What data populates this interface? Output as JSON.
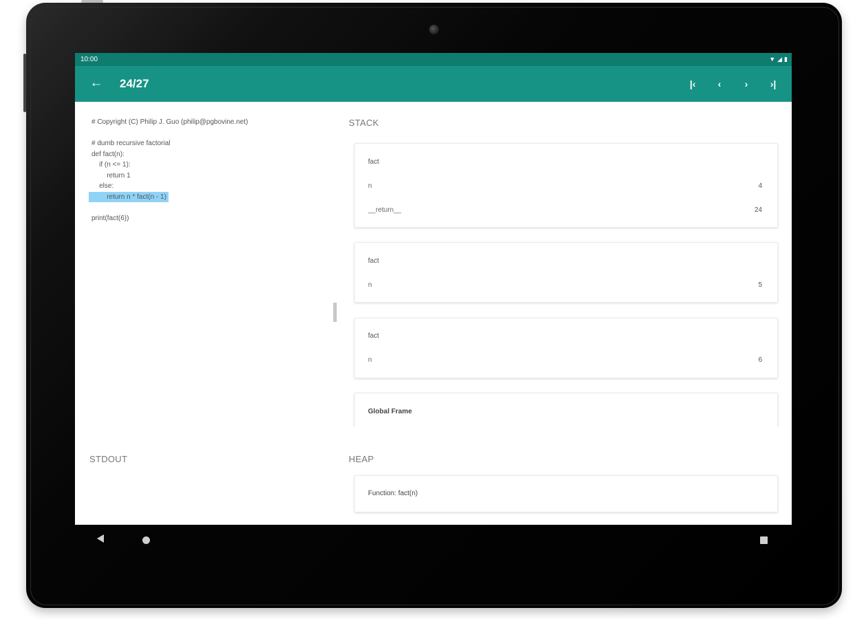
{
  "statusbar": {
    "time": "10:00",
    "icons": [
      "wifi-icon",
      "signal-icon",
      "battery-icon"
    ]
  },
  "toolbar": {
    "back_icon": "arrow-left-icon",
    "title": "24/27",
    "nav": [
      {
        "name": "first-step-button",
        "icon": "skip-first-icon",
        "glyph": "⏮"
      },
      {
        "name": "prev-step-button",
        "icon": "chevron-left-icon",
        "glyph": "‹"
      },
      {
        "name": "next-step-button",
        "icon": "chevron-right-icon",
        "glyph": "›"
      },
      {
        "name": "last-step-button",
        "icon": "skip-last-icon",
        "glyph": "⏭"
      }
    ]
  },
  "code": {
    "lines": [
      {
        "text": "# Copyright (C) Philip J. Guo (philip@pgbovine.net)",
        "highlight": false
      },
      {
        "text": "",
        "highlight": false
      },
      {
        "text": "# dumb recursive factorial",
        "highlight": false
      },
      {
        "text": "def fact(n):",
        "highlight": false
      },
      {
        "text": "    if (n <= 1):",
        "highlight": false
      },
      {
        "text": "        return 1",
        "highlight": false
      },
      {
        "text": "    else:",
        "highlight": false
      },
      {
        "text": "        return n * fact(n - 1)",
        "highlight": true
      },
      {
        "text": "",
        "highlight": false
      },
      {
        "text": "print(fact(6))",
        "highlight": false
      }
    ]
  },
  "stack": {
    "title": "STACK",
    "frames": [
      {
        "name": "fact",
        "vars": [
          {
            "name": "n",
            "value": "4"
          },
          {
            "name": "__return__",
            "value": "24"
          }
        ]
      },
      {
        "name": "fact",
        "vars": [
          {
            "name": "n",
            "value": "5"
          }
        ]
      },
      {
        "name": "fact",
        "vars": [
          {
            "name": "n",
            "value": "6"
          }
        ]
      },
      {
        "name": "Global Frame",
        "vars": []
      }
    ]
  },
  "stdout": {
    "title": "STDOUT"
  },
  "heap": {
    "title": "HEAP",
    "objects": [
      {
        "label": "Function: fact(n)"
      }
    ]
  },
  "colors": {
    "statusbar": "#0f7c70",
    "toolbar": "#179385",
    "highlight": "#8fd3f7"
  }
}
